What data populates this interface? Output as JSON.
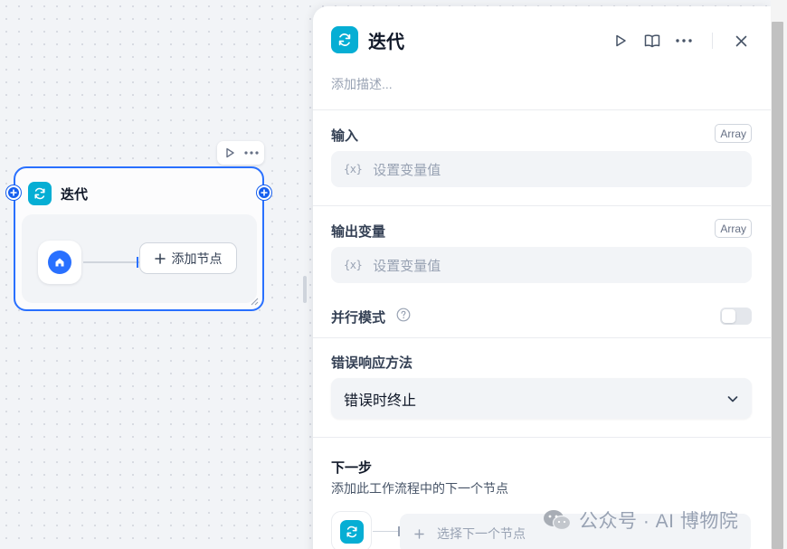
{
  "canvas": {
    "node": {
      "title": "迭代",
      "add_node_label": "添加节点"
    }
  },
  "panel": {
    "title": "迭代",
    "description_placeholder": "添加描述...",
    "input": {
      "label": "输入",
      "type_badge": "Array",
      "placeholder": "设置变量值",
      "var_symbol": "{x}"
    },
    "output": {
      "label": "输出变量",
      "type_badge": "Array",
      "placeholder": "设置变量值",
      "var_symbol": "{x}"
    },
    "parallel_mode": {
      "label": "并行模式",
      "enabled": false
    },
    "error_handling": {
      "label": "错误响应方法",
      "selected": "错误时终止"
    },
    "next_step": {
      "title": "下一步",
      "description": "添加此工作流程中的下一个节点",
      "select_placeholder": "选择下一个节点"
    }
  },
  "watermark": {
    "text": "公众号 · AI 博物院"
  },
  "icons": {
    "app": "iteration-loop-icon",
    "start": "home-icon",
    "run": "play-icon",
    "docs": "book-icon",
    "more": "ellipsis-icon",
    "close": "close-icon",
    "help": "question-circle-icon",
    "chevron": "chevron-down-icon",
    "plus": "plus-icon"
  },
  "colors": {
    "accent": "#2970ff",
    "iteration_icon_bg": "#06aed4",
    "node_border": "#2970ff"
  }
}
